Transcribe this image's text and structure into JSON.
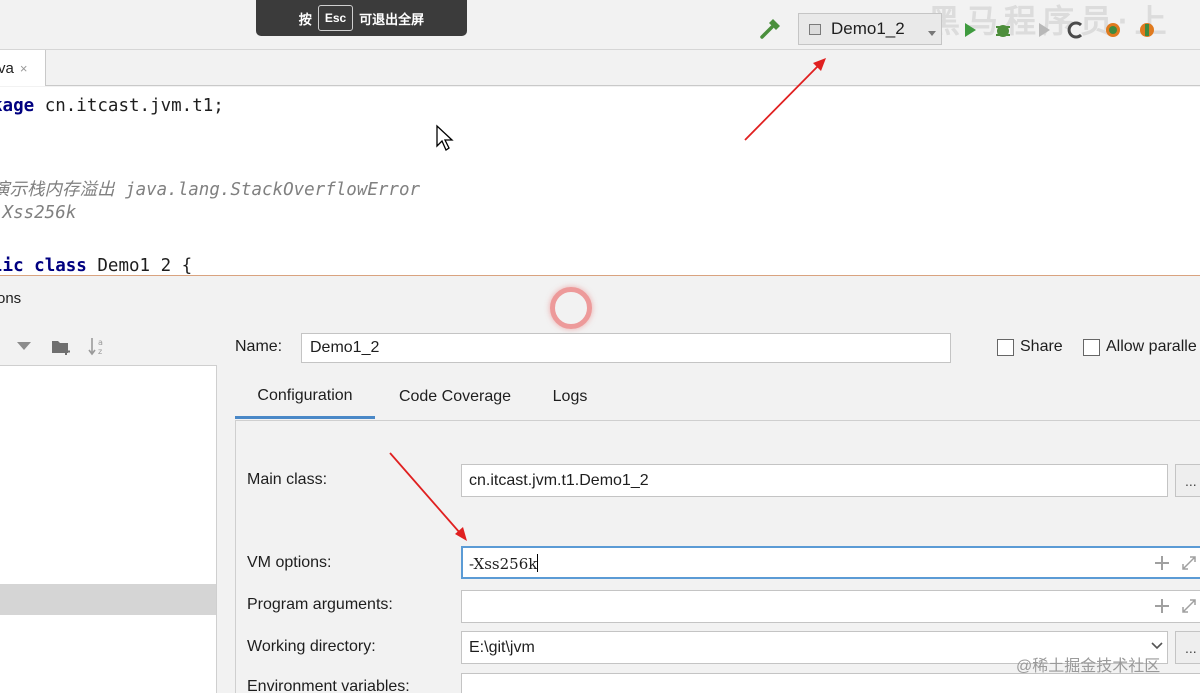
{
  "esc_hint": {
    "prefix": "按",
    "key": "Esc",
    "suffix": "可退出全屏"
  },
  "toolbar": {
    "run_config": "Demo1_2",
    "watermark": "黑马程序员·上"
  },
  "editor": {
    "tab_label": "va",
    "tab_close": "×",
    "lines": {
      "l1_kw": "kage",
      "l1_rest": " cn.itcast.jvm.t1;",
      "l2": "演示栈内存溢出 java.lang.StackOverflowError",
      "l3": "-Xss256k",
      "l4_kw1": "lic",
      "l4_kw2": "class",
      "l4_rest": " Demo1 2 {"
    }
  },
  "dialog": {
    "title": "ons",
    "name_label": "Name:",
    "name_value": "Demo1_2",
    "share_label": "Share",
    "allow_parallel_label": "Allow paralle",
    "tabs": [
      "Configuration",
      "Code Coverage",
      "Logs"
    ],
    "fields": {
      "main_class_label": "Main class:",
      "main_class_value": "cn.itcast.jvm.t1.Demo1_2",
      "vm_options_label": "VM options:",
      "vm_options_value": "-Xss256k",
      "program_args_label": "Program arguments:",
      "program_args_value": "",
      "working_dir_label": "Working directory:",
      "working_dir_value": "E:\\git\\jvm",
      "env_vars_label": "Environment variables:",
      "env_vars_value": ""
    },
    "browse_label": "...",
    "plus": "+"
  },
  "watermark_bottom": "@稀土掘金技术社区"
}
